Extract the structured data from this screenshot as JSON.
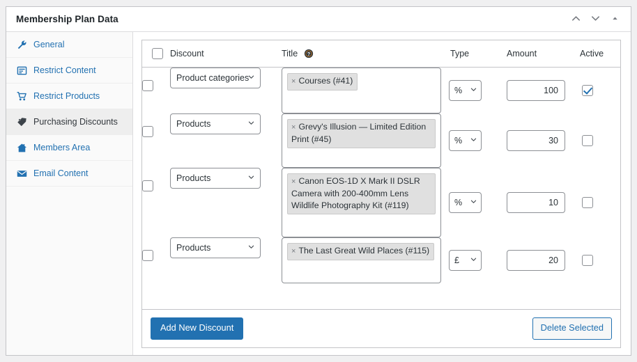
{
  "panel": {
    "title": "Membership Plan Data",
    "actions": [
      {
        "name": "move-up",
        "icon": "chevron-up-icon"
      },
      {
        "name": "move-down",
        "icon": "chevron-down-icon"
      },
      {
        "name": "toggle-panel",
        "icon": "triangle-up-icon"
      }
    ]
  },
  "sidebar": {
    "items": [
      {
        "label": "General",
        "icon": "wrench-icon",
        "active": false
      },
      {
        "label": "Restrict Content",
        "icon": "document-icon",
        "active": false
      },
      {
        "label": "Restrict Products",
        "icon": "cart-icon",
        "active": false
      },
      {
        "label": "Purchasing Discounts",
        "icon": "tag-icon",
        "active": true
      },
      {
        "label": "Members Area",
        "icon": "home-icon",
        "active": false
      },
      {
        "label": "Email Content",
        "icon": "envelope-icon",
        "active": false
      }
    ]
  },
  "table": {
    "select_all_checked": false,
    "columns": {
      "discount": "Discount",
      "title": "Title",
      "type": "Type",
      "amount": "Amount",
      "active": "Active"
    },
    "title_help_icon": "help-icon",
    "rows": [
      {
        "selected": false,
        "discount_type": "Product categories",
        "tags": [
          "Courses (#41)"
        ],
        "type": "%",
        "amount": "100",
        "active": true
      },
      {
        "selected": false,
        "discount_type": "Products",
        "tags": [
          "Grevy's Illusion — Limited Edition Print (#45)"
        ],
        "type": "%",
        "amount": "30",
        "active": false
      },
      {
        "selected": false,
        "discount_type": "Products",
        "tags": [
          "Canon EOS-1D X Mark II DSLR Camera with 200-400mm Lens Wildlife Photography Kit (#119)"
        ],
        "type": "%",
        "amount": "10",
        "active": false
      },
      {
        "selected": false,
        "discount_type": "Products",
        "tags": [
          "The Last Great Wild Places (#115)"
        ],
        "type": "£",
        "amount": "20",
        "active": false
      }
    ]
  },
  "footer": {
    "add_label": "Add New Discount",
    "delete_label": "Delete Selected"
  },
  "colors": {
    "accent": "#2271b1",
    "link": "#2271b1",
    "border": "#c3c4c7",
    "chip_bg": "#e0e0e0",
    "active_nav_bg": "#eeeeee"
  }
}
